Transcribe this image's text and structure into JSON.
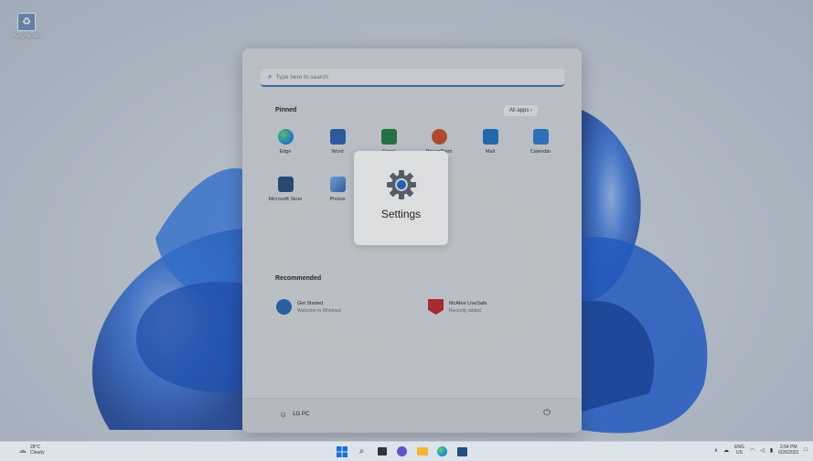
{
  "desktop": {
    "recycle_bin_label": "Recycle Bin"
  },
  "start_menu": {
    "search_placeholder": "Type here to search",
    "pinned_title": "Pinned",
    "all_apps_label": "All apps  ›",
    "pinned_apps": [
      {
        "label": "Edge",
        "icon": "edge-icon",
        "color": "#1f8fd6"
      },
      {
        "label": "Word",
        "icon": "word-icon",
        "color": "#2b5eaf"
      },
      {
        "label": "Excel",
        "icon": "excel-icon",
        "color": "#1f7a45"
      },
      {
        "label": "PowerPoint",
        "icon": "powerpoint-icon",
        "color": "#c94b28"
      },
      {
        "label": "Mail",
        "icon": "mail-icon",
        "color": "#1d6fbf"
      },
      {
        "label": "Calendar",
        "icon": "calendar-icon",
        "color": "#2a7ad0"
      },
      {
        "label": "Microsoft Store",
        "icon": "store-icon",
        "color": "#204e7e"
      },
      {
        "label": "Photos",
        "icon": "photos-icon",
        "color": "#3b79c2"
      }
    ],
    "recommended_title": "Recommended",
    "recommended": [
      {
        "title": "Get Started",
        "subtitle": "Welcome to Windows",
        "icon": "get-started-icon",
        "color": "#2466b3"
      },
      {
        "title": "McAfee LiveSafe",
        "subtitle": "Recently added",
        "icon": "mcafee-icon",
        "color": "#c0262d"
      }
    ],
    "user_name": "LG PC"
  },
  "settings_callout": {
    "label": "Settings",
    "icon": "gear-icon"
  },
  "taskbar": {
    "weather_temp": "28°C",
    "weather_desc": "Cloudy",
    "apps": [
      "windows-start-icon",
      "search-icon",
      "task-view-icon",
      "chat-icon",
      "file-explorer-icon",
      "edge-icon",
      "store-icon"
    ],
    "lang_line1": "ENG",
    "lang_line2": "US",
    "time": "2:54 PM",
    "date": "6/26/2022"
  },
  "colors": {
    "accent": "#3c6fb0",
    "wallpaper_blue": "#1e5fd8"
  }
}
